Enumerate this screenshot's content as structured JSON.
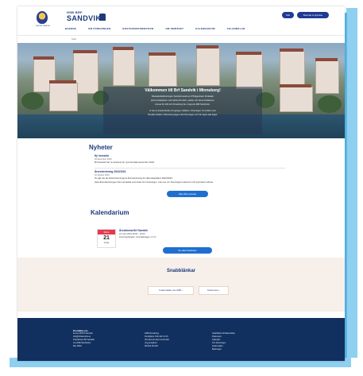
{
  "brand": {
    "emblem_text": "HSB BRF SANDVIK",
    "top": "HSB BRF",
    "name": "SANDVIK"
  },
  "header": {
    "search_label": "Sök",
    "login_label": "Boende & styrelse"
  },
  "nav": {
    "items": [
      "BOENDE",
      "OM FÖRENINGEN",
      "BOSTADSINFORMATION",
      "OM OMRÅDET",
      "KALENDARIUM",
      "FELANMÄLAN"
    ]
  },
  "breadcrumb": "Start",
  "hero": {
    "title": "Välkommen till Brf Sandvik i Minneberg!",
    "lines": [
      "Bostadsrättsföreningen Sandvik består av 278 lägenheter fördelade",
      "på fyra fastigheter med närhet till vatten, parker och kommunikationer.",
      "Ansvar för drift och förvaltning har vi lagt på HSB Stockholm.",
      "Vi har en kvartersbutik och garage i källaren. Föreningen Tre Fröken som",
      "förvaltar lokalen i Minneberg ligger nära föreningen och har öppet alla dagar."
    ]
  },
  "news": {
    "title": "Nyheter",
    "items": [
      {
        "title": "Ny hemsida",
        "date": "20 december 2023",
        "text": "Brf Sandvik har nu lanserat sin nya hemsida december 2023."
      },
      {
        "title": "Årsredovisning 2022/2023",
        "date": "10 oktober 2023",
        "text": "Nu går det att hämta föreningens årsredovisning för räkenskapsåret 2022/2023."
      },
      {
        "title": "",
        "date": "",
        "text": "Hela årsredovisningen finns att ladda ned under Om föreningen. Läs mer om föreningens ekonomi och styrelsens arbete."
      }
    ],
    "more_label": "Alla våra nyheter"
  },
  "calendar": {
    "title": "Kalendarium",
    "event": {
      "month": "Mars",
      "day": "21",
      "weekday": "tisdag",
      "title": "Årsstämma Brf Sandvik",
      "time": "21 mars 2024 18:30 – 20:00",
      "place": "Föreningslokalen, Gröndalsvägen 1 3 17"
    },
    "more_label": "Se alla händelser"
  },
  "quicklinks": {
    "title": "Snabblänkar",
    "items": [
      "Felanmälan via HSB ›",
      "Dokument ›"
    ]
  },
  "footer": {
    "col1": {
      "head": "Kontakta oss",
      "lines": [
        "E-post till Brf Sandvik",
        "info@brfsandvik.se",
        "",
        "Postadress Brf Sandvik",
        "c/o HSB Stockholm",
        "Box 8310",
        "104 20 Stockholm"
      ]
    },
    "col2": {
      "head": "",
      "lines": [
        "HSB förvaltning",
        "Kundtjänst 010-442 11 00",
        "",
        "Vid akut fel efter kontorstid",
        "ring jourtjänst",
        "08-522 48 000",
        "Jourtelefon dygnet runt"
      ]
    },
    "col3": {
      "head": "",
      "lines": [
        "Snabblänk till felanmälan",
        "Dokument",
        "Kalender",
        "Om föreningen",
        "Felanmälan",
        "Bokningar",
        "Integritetspolicy"
      ]
    }
  }
}
